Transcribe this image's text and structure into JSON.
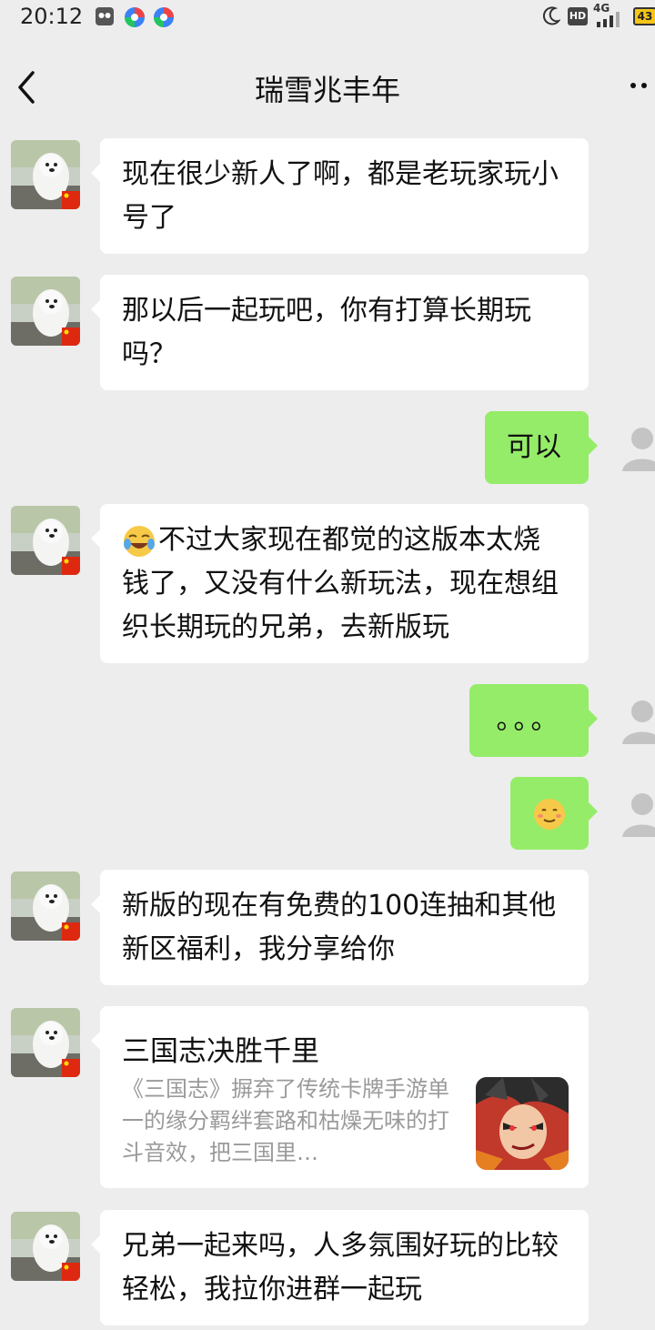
{
  "status": {
    "time": "20:12",
    "hd": "HD",
    "net": "4G",
    "battery": "43"
  },
  "chat": {
    "title": "瑞雪兆丰年"
  },
  "messages": [
    {
      "text": "现在很少新人了啊，都是老玩家玩小号了"
    },
    {
      "text": "那以后一起玩吧，你有打算长期玩吗？"
    },
    {
      "text": "可以"
    },
    {
      "text": "不过大家现在都觉的这版本太烧钱了，又没有什么新玩法，现在想组织长期玩的兄弟，去新版玩"
    },
    {
      "text": "。。。"
    },
    {
      "text": "新版的现在有免费的100连抽和其他新区福利，我分享给你"
    },
    {
      "card_title": "三国志决胜千里",
      "card_desc": "《三国志》摒弃了传统卡牌手游单一的缘分羁绊套路和枯燥无味的打斗音效，把三国里…"
    },
    {
      "text": "兄弟一起来吗，人多氛围好玩的比较轻松，我拉你进群一起玩"
    }
  ],
  "icons": {
    "back": "chevron-left-icon",
    "more": "more-dots-icon",
    "crying_laughing": "face-with-tears-of-joy",
    "shy": "smiling-face"
  }
}
